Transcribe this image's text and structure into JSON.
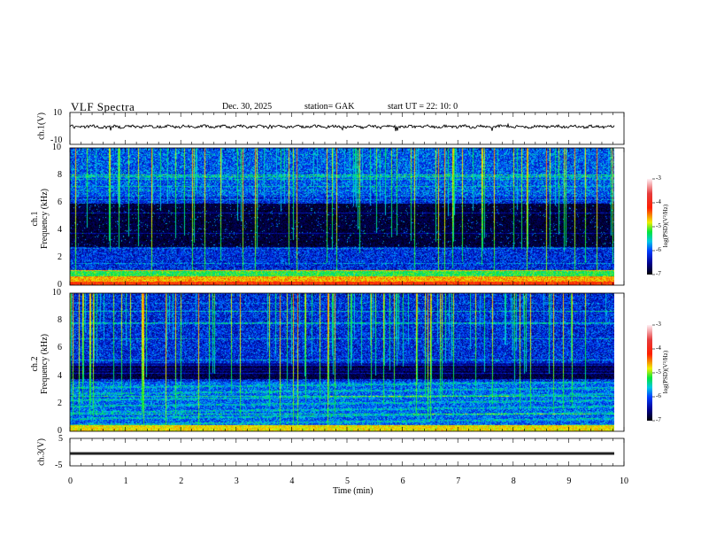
{
  "header": {
    "title": "VLF  Spectra",
    "date": "Dec. 30,  2025",
    "station": "station= GAK",
    "start_ut": "start  UT  =    22: 10: 0"
  },
  "chart_data": [
    {
      "type": "line",
      "ylabel": "ch.1(V)",
      "ylim": [
        -10,
        10
      ],
      "yticks": [
        "10",
        "-10"
      ],
      "xlim": [
        0,
        10
      ],
      "description_values": {
        "mean": 0,
        "noise_amplitude": 2
      }
    },
    {
      "type": "heatmap",
      "ylabel": "ch.1\nFrequency  (kHz)",
      "ylim": [
        0,
        10
      ],
      "yticks": [
        "0",
        "2",
        "4",
        "6",
        "8",
        "10"
      ],
      "xlim": [
        0,
        10
      ],
      "data_end_min": 9.83,
      "colorbar": {
        "label": "log(PSD)(V²/Hz)",
        "range": [
          -7,
          -3
        ],
        "ticks": [
          "-3",
          "-4",
          "-5",
          "-6",
          "-7"
        ]
      }
    },
    {
      "type": "heatmap",
      "ylabel": "ch.2\nFrequency  (kHz)",
      "ylim": [
        0,
        10
      ],
      "yticks": [
        "0",
        "2",
        "4",
        "6",
        "8",
        "10"
      ],
      "xlim": [
        0,
        10
      ],
      "data_end_min": 9.83,
      "colorbar": {
        "label": "log(PSD)(V²/Hz)",
        "range": [
          -7,
          -3
        ],
        "ticks": [
          "-3",
          "-4",
          "-5",
          "-6",
          "-7"
        ]
      }
    },
    {
      "type": "line",
      "ylabel": "ch.3(V)",
      "ylim": [
        -5,
        5
      ],
      "yticks": [
        "5",
        "-5"
      ],
      "xlim": [
        0,
        10
      ],
      "description_values": {
        "level": -0.5
      }
    }
  ],
  "xaxis": {
    "label": "Time  (min)",
    "ticks": [
      "0",
      "1",
      "2",
      "3",
      "4",
      "5",
      "6",
      "7",
      "8",
      "9",
      "10"
    ]
  },
  "colors": {
    "axis": "#000000"
  }
}
